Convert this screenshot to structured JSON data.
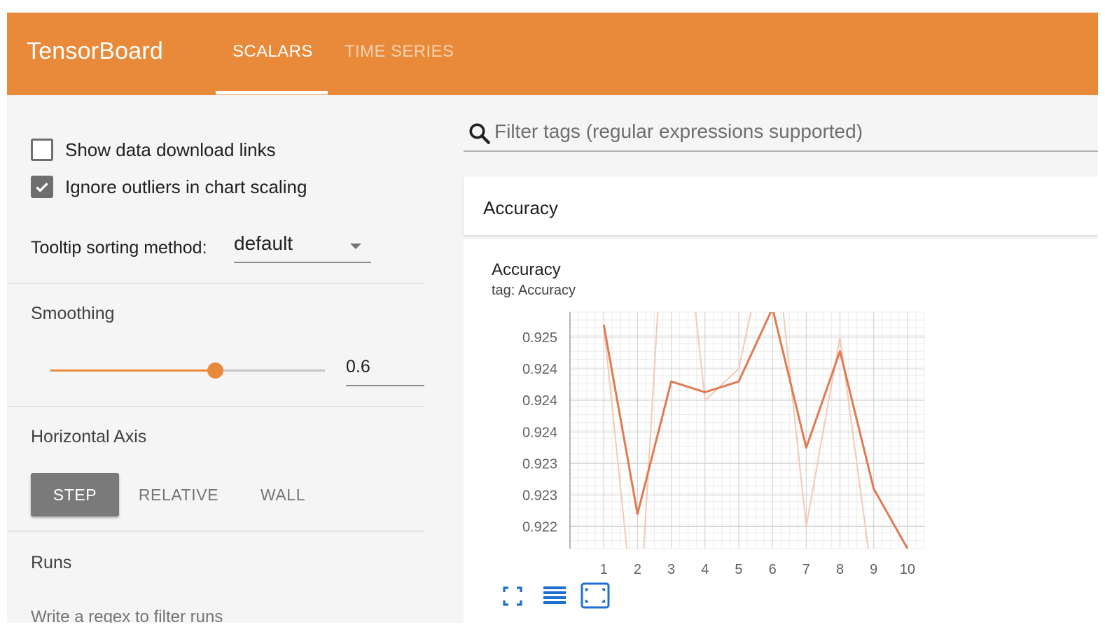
{
  "header": {
    "brand": "TensorBoard",
    "tabs": [
      {
        "label": "SCALARS",
        "active": true
      },
      {
        "label": "TIME SERIES",
        "active": false
      }
    ],
    "color": "#e88a3a"
  },
  "sidebar": {
    "checkboxes": [
      {
        "label": "Show data download links",
        "checked": false
      },
      {
        "label": "Ignore outliers in chart scaling",
        "checked": true
      }
    ],
    "tooltip_sorting": {
      "label": "Tooltip sorting method:",
      "value": "default"
    },
    "smoothing": {
      "title": "Smoothing",
      "value": "0.6",
      "fraction": 0.6
    },
    "horizontal_axis": {
      "title": "Horizontal Axis",
      "options": [
        "STEP",
        "RELATIVE",
        "WALL"
      ],
      "selected": "STEP"
    },
    "runs": {
      "title": "Runs",
      "placeholder": "Write a regex to filter runs"
    }
  },
  "main": {
    "search": {
      "placeholder": "Filter tags (regular expressions supported)",
      "icon": "search-icon"
    },
    "group_title": "Accuracy",
    "card": {
      "title": "Accuracy",
      "subtitle": "tag: Accuracy"
    },
    "controls": [
      "fullscreen-icon",
      "toggle-y-log-icon",
      "fit-domain-icon"
    ]
  },
  "chart_data": {
    "type": "line",
    "title": "Accuracy",
    "xlabel": "",
    "ylabel": "",
    "x": [
      1,
      2,
      3,
      4,
      5,
      6,
      7,
      8,
      9,
      10
    ],
    "xticks": [
      "1",
      "2",
      "3",
      "4",
      "5",
      "6",
      "7",
      "8",
      "9",
      "10"
    ],
    "yticks": [
      "0.925",
      "0.924",
      "0.924",
      "0.924",
      "0.923",
      "0.923",
      "0.922"
    ],
    "ytick_values": [
      0.925,
      0.9245,
      0.924,
      0.9235,
      0.923,
      0.9225,
      0.922
    ],
    "ylim": [
      0.92165,
      0.9254
    ],
    "series": [
      {
        "role": "smoothed",
        "color": "#e07a50",
        "values": [
          0.9252,
          0.9222,
          0.9243,
          0.92413,
          0.9243,
          0.92546,
          0.92325,
          0.92478,
          0.9226,
          0.92165
        ]
      },
      {
        "role": "raw",
        "color": "#f4c9b5",
        "values": [
          0.9252,
          0.92,
          0.929,
          0.924,
          0.9245,
          0.927,
          0.922,
          0.925,
          0.921,
          0.9205
        ]
      }
    ],
    "grid": true
  }
}
